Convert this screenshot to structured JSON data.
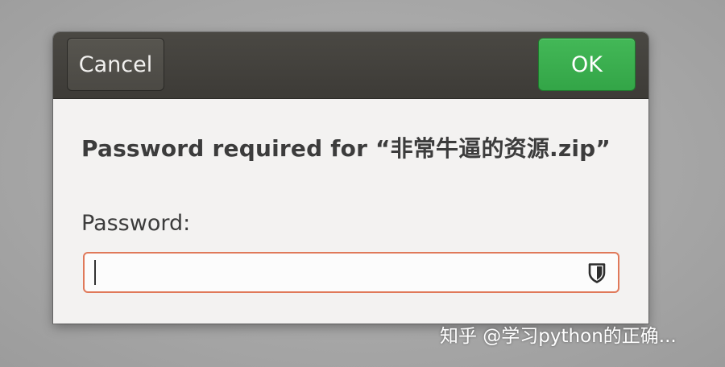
{
  "dialog": {
    "cancel_label": "Cancel",
    "ok_label": "OK",
    "title": "Password required for “非常牛逼的资源.zip”",
    "password_label": "Password:",
    "password_value": "",
    "caps_lock_icon": "shield-icon"
  },
  "colors": {
    "ok_button": "#3bb04f",
    "headerbar": "#45433e",
    "entry_focus_border": "#e0795a",
    "dialog_background": "#f3f2f1"
  },
  "watermark": {
    "text": "知乎 @学习python的正确..."
  }
}
